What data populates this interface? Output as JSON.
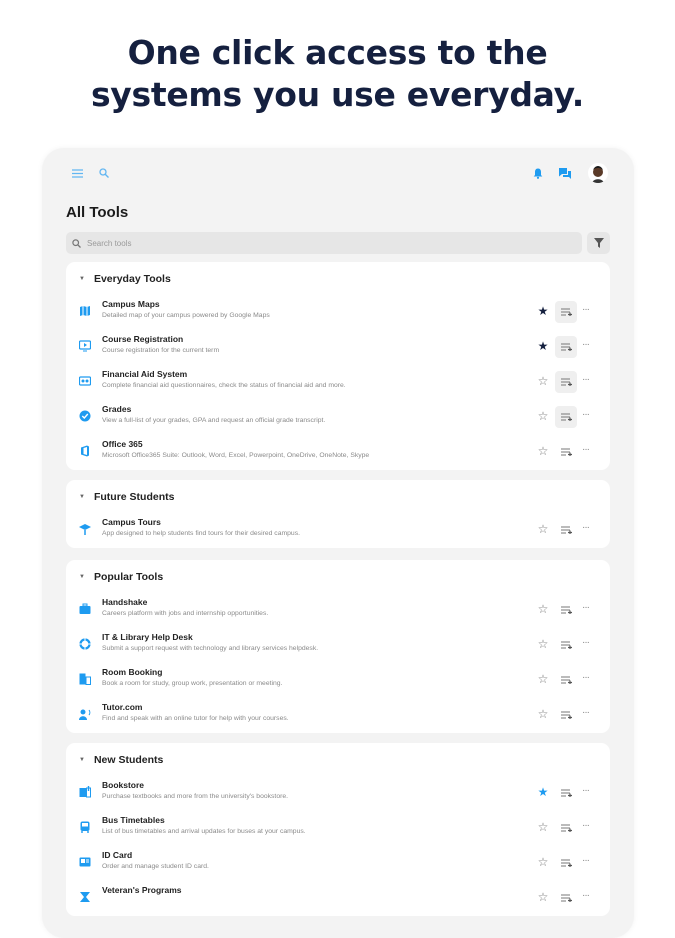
{
  "headline": {
    "line1": "One click access to the",
    "line2": "systems you use everyday."
  },
  "colors": {
    "accent": "#1e9bf0",
    "navy": "#15203f"
  },
  "topbar": {
    "icons": [
      "menu-icon",
      "search-icon",
      "bell-icon",
      "chat-icon",
      "avatar"
    ]
  },
  "page_title": "All Tools",
  "search": {
    "placeholder": "Search tools"
  },
  "sections": [
    {
      "title": "Everyday Tools",
      "items": [
        {
          "title": "Campus Maps",
          "desc": "Detailed map of your campus powered by Google Maps",
          "icon": "map-icon",
          "star": "dark",
          "highlight": true
        },
        {
          "title": "Course Registration",
          "desc": "Course registration for the current term",
          "icon": "monitor-icon",
          "star": "dark",
          "highlight": true
        },
        {
          "title": "Financial Aid System",
          "desc": "Complete financial aid questionnaires, check the status of financial aid and more.",
          "icon": "financial-aid-icon",
          "star": "none",
          "highlight": true
        },
        {
          "title": "Grades",
          "desc": "View a full-list of your grades, GPA and request an official grade transcript.",
          "icon": "check-circle-icon",
          "star": "none",
          "highlight": true
        },
        {
          "title": "Office 365",
          "desc": "Microsoft Office365 Suite: Outlook, Word, Excel, Powerpoint, OneDrive, OneNote, Skype",
          "icon": "office-icon",
          "star": "none",
          "highlight": false
        }
      ]
    },
    {
      "title": "Future Students",
      "items": [
        {
          "title": "Campus Tours",
          "desc": "App designed to help students find tours for their desired campus.",
          "icon": "graduation-cap-icon",
          "star": "none",
          "highlight": false
        }
      ]
    },
    {
      "title": "Popular Tools",
      "items": [
        {
          "title": "Handshake",
          "desc": "Careers platform with jobs and internship opportunities.",
          "icon": "briefcase-icon",
          "star": "none",
          "highlight": false
        },
        {
          "title": "IT & Library Help Desk",
          "desc": "Submit a support request with technology and library services helpdesk.",
          "icon": "lifebuoy-icon",
          "star": "none",
          "highlight": false
        },
        {
          "title": "Room Booking",
          "desc": "Book a room for study, group work, presentation or meeting.",
          "icon": "room-icon",
          "star": "none",
          "highlight": false
        },
        {
          "title": "Tutor.com",
          "desc": "Find and speak with an online tutor for help with your courses.",
          "icon": "tutor-icon",
          "star": "none",
          "highlight": false
        }
      ]
    },
    {
      "title": "New Students",
      "items": [
        {
          "title": "Bookstore",
          "desc": "Purchase textbooks and more from the university's bookstore.",
          "icon": "book-icon",
          "star": "blue",
          "highlight": false
        },
        {
          "title": "Bus Timetables",
          "desc": "List of bus timetables and arrival updates for buses at your campus.",
          "icon": "bus-icon",
          "star": "none",
          "highlight": false
        },
        {
          "title": "ID Card",
          "desc": "Order and manage student ID card.",
          "icon": "id-card-icon",
          "star": "none",
          "highlight": false
        },
        {
          "title": "Veteran's Programs",
          "desc": "",
          "icon": "veteran-icon",
          "star": "none",
          "highlight": false
        }
      ]
    }
  ]
}
